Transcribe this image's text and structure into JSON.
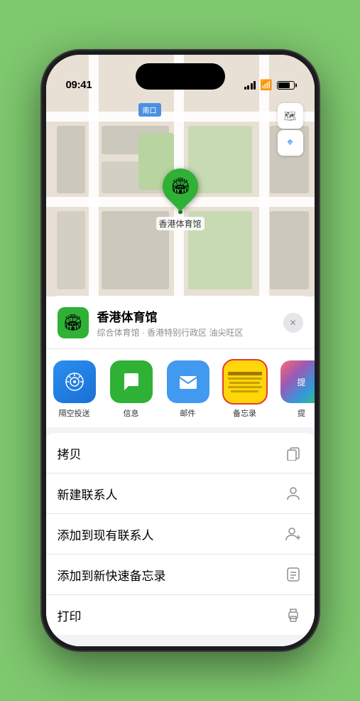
{
  "status": {
    "time": "09:41",
    "location_arrow": "▶"
  },
  "map": {
    "label": "南口",
    "location_name": "香港体育馆",
    "marker_emoji": "🏟"
  },
  "location_card": {
    "name": "香港体育馆",
    "subtitle": "综合体育馆 · 香港特别行政区 油尖旺区",
    "icon_emoji": "🏟"
  },
  "share_apps": [
    {
      "id": "airdrop",
      "label": "隔空投送",
      "type": "airdrop"
    },
    {
      "id": "messages",
      "label": "信息",
      "type": "messages"
    },
    {
      "id": "mail",
      "label": "邮件",
      "type": "mail"
    },
    {
      "id": "notes",
      "label": "备忘录",
      "type": "notes"
    },
    {
      "id": "more",
      "label": "提",
      "type": "more"
    }
  ],
  "actions": [
    {
      "id": "copy",
      "label": "拷贝",
      "icon": "copy"
    },
    {
      "id": "new-contact",
      "label": "新建联系人",
      "icon": "person"
    },
    {
      "id": "add-existing",
      "label": "添加到现有联系人",
      "icon": "person-add"
    },
    {
      "id": "add-notes",
      "label": "添加到新快速备忘录",
      "icon": "note"
    },
    {
      "id": "print",
      "label": "打印",
      "icon": "print"
    }
  ],
  "controls": {
    "map_icon": "🗺",
    "location_icon": "◎"
  }
}
